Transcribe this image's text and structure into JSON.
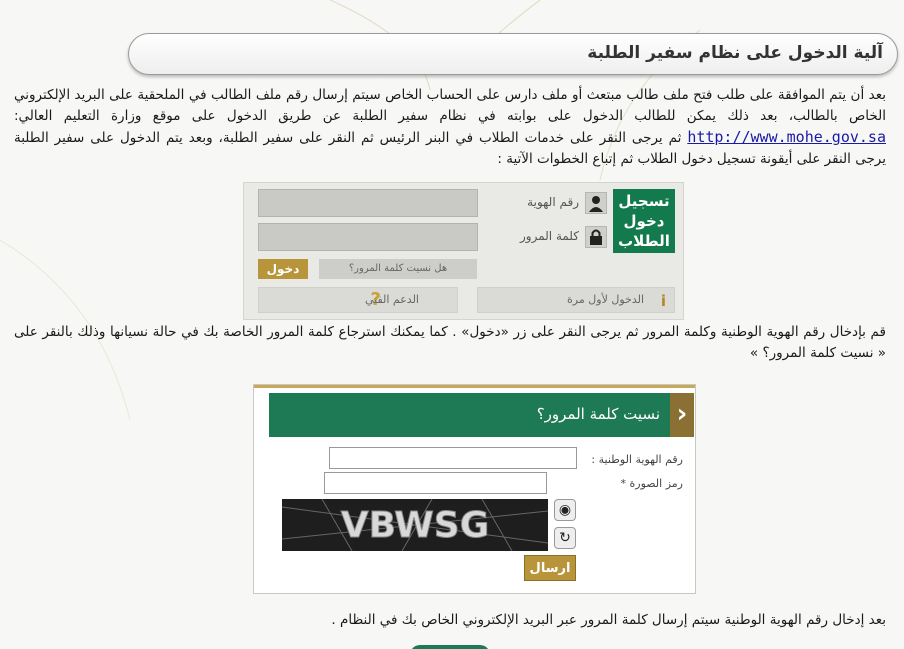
{
  "title": "آلية الدخول على نظام سفير الطلبة",
  "paragraphs": {
    "p1_part1": "بعد أن يتم الموافقة على طلب فتح ملف طالب مبتعث أو ملف دارس على الحساب الخاص سيتم إرسال رقم ملف الطالب في الملحقية على البريد الإلكتروني الخاص بالطالب، بعد ذلك يمكن للطالب الدخول على بوابته في نظام سفير الطلبة عن طريق الدخول على موقع وزارة التعليم العالي:",
    "p1_link": "http://www.mohe.gov.sa",
    "p1_part2": "ثم يرجى النقر على خدمات الطلاب في البنر الرئيس ثم النقر على سفير الطلبة، وبعد يتم الدخول على سفير الطلبة يرجى النقر على أيقونة تسجيل دخول الطلاب ثم إتباع الخطوات الآتية :",
    "p2": "قم بإدخال رقم الهوية الوطنية وكلمة المرور ثم يرجى النقر على زر «دخول» . كما يمكنك استرجاع كلمة المرور الخاصة بك في حالة نسيانها وذلك بالنقر على « نسيت كلمة المرور؟ »",
    "p3": "بعد إدخال رقم الهوية الوطنية سيتم إرسال كلمة المرور عبر البريد الإلكتروني الخاص بك في النظام ."
  },
  "login_panel": {
    "register_title": "تسجيل دخول الطلاب",
    "id_label": "رقم الهوية",
    "password_label": "كلمة المرور",
    "enter_button": "دخول",
    "forgot_link": "هل نسيت كلمة المرور؟",
    "first_time": "الدخول لأول مرة",
    "support": "الدعم الفني",
    "icons": {
      "id": "user-icon",
      "password": "lock-icon",
      "first_time": "info-icon",
      "support": "question-icon"
    }
  },
  "forgot_panel": {
    "header": "نسيت كلمة المرور؟",
    "national_id_label": "رقم الهوية الوطنية :",
    "captcha_label": "رمز الصورة *",
    "captcha_text": "VBWSG",
    "send_button": "ارسال",
    "icons": {
      "back": "chevron-left-icon",
      "audio": "speaker-icon",
      "refresh": "refresh-icon"
    }
  },
  "colors": {
    "green": "#127a4c",
    "gold": "#b8943a"
  }
}
